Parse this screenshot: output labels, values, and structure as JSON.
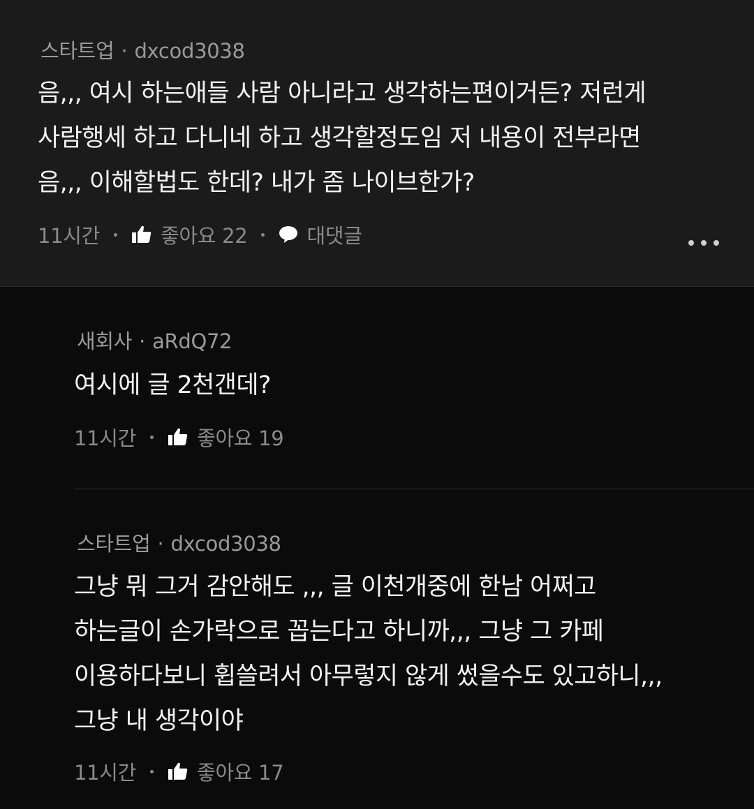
{
  "comments": [
    {
      "category": "스타트업",
      "author": "dxcod3038",
      "text": "음,,, 여시 하는애들 사람 아니라고 생각하는편이거든? 저런게\n사람행세 하고 다니네 하고 생각할정도임  저 내용이 전부라면\n음,,, 이해할법도 한데? 내가 좀 나이브한가?",
      "time": "11시간",
      "likes_label": "좋아요 22",
      "reply_label": "대댓글"
    }
  ],
  "replies": [
    {
      "category": "새회사",
      "author": "aRdQ72",
      "text": "여시에 글 2천갠데?",
      "time": "11시간",
      "likes_label": "좋아요 19"
    },
    {
      "category": "스타트업",
      "author": "dxcod3038",
      "text": "그냥 뭐 그거 감안해도 ,,, 글 이천개중에 한남 어쩌고\n하는글이 손가락으로 꼽는다고 하니까,,, 그냥 그 카페\n이용하다보니 휩쓸려서 아무렇지 않게 썼을수도 있고하니,,,\n그냥 내 생각이야",
      "time": "11시간",
      "likes_label": "좋아요 17"
    }
  ],
  "separator": "·",
  "icons": {
    "like": "thumbs-up-icon",
    "reply": "speech-bubble-icon",
    "more": "more-options-icon"
  },
  "colors": {
    "top_comment_bg": "#1b1b1b",
    "page_bg": "#0b0b0b",
    "body_text": "#f2f2f2",
    "meta_text": "#9a9a9a"
  }
}
